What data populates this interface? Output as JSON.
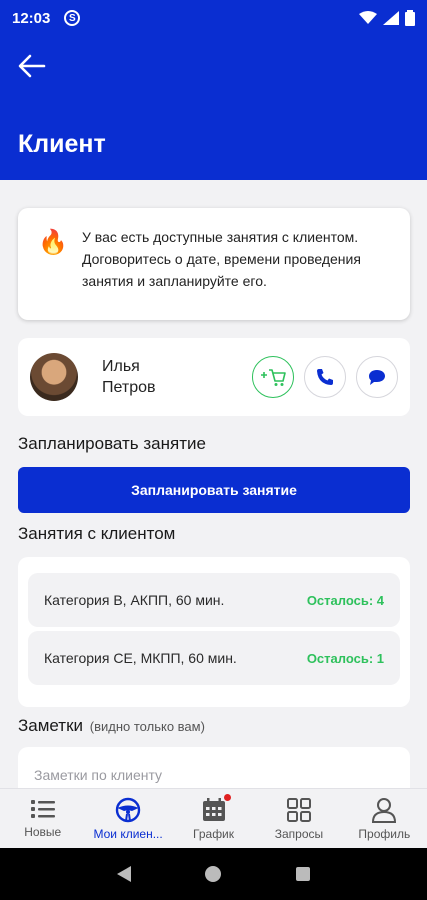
{
  "status_bar": {
    "time": "12:03",
    "app_icon": "S"
  },
  "app_bar": {
    "title": "Клиент"
  },
  "notice": {
    "text": "У вас есть доступные занятия с клиентом. Договоритесь о дате, времени проведения занятия и запланируйте его."
  },
  "client": {
    "first_name": "Илья",
    "last_name": "Петров"
  },
  "plan": {
    "section_title": "Запланировать занятие",
    "button_label": "Запланировать занятие"
  },
  "lessons": {
    "section_title": "Занятия с клиентом",
    "items": [
      {
        "name": "Категория B, АКПП, 60 мин.",
        "remaining": "Осталось: 4"
      },
      {
        "name": "Категория СЕ, МКПП, 60 мин.",
        "remaining": "Осталось: 1"
      }
    ]
  },
  "notes": {
    "title": "Заметки",
    "hint": "(видно только вам)",
    "placeholder": "Заметки по клиенту"
  },
  "bottom_nav": [
    {
      "label": "Новые",
      "icon": "list-icon"
    },
    {
      "label": "Мои клиен...",
      "icon": "steering-wheel-icon"
    },
    {
      "label": "График",
      "icon": "calendar-icon"
    },
    {
      "label": "Запросы",
      "icon": "grid-icon"
    },
    {
      "label": "Профиль",
      "icon": "person-icon"
    }
  ],
  "colors": {
    "primary": "#0a2ed1",
    "success": "#2ec15c",
    "badge": "#e02020"
  }
}
